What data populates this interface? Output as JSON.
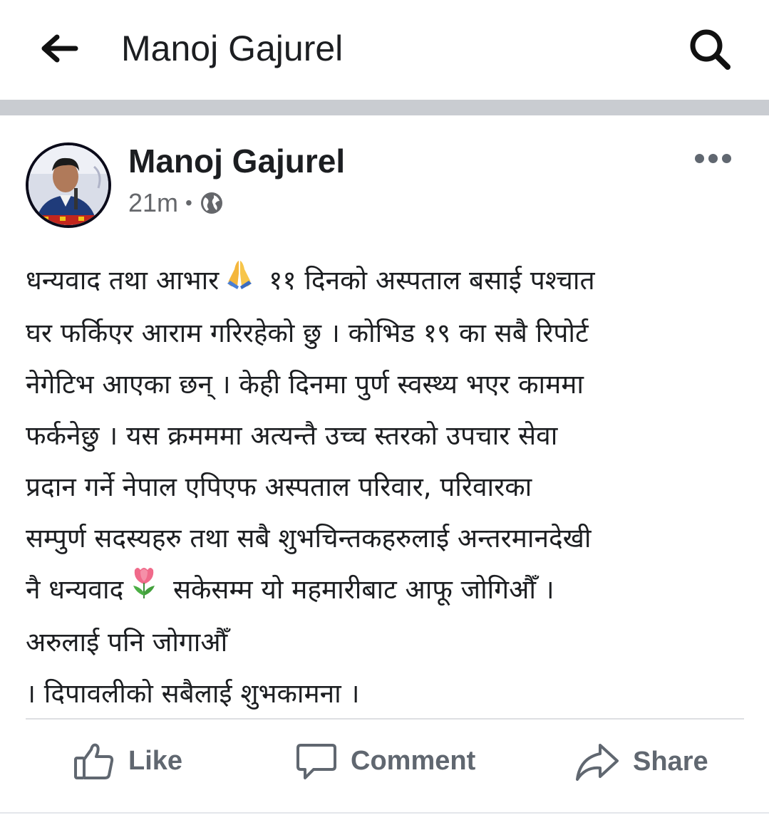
{
  "header": {
    "back_icon": "arrow-left-icon",
    "title": "Manoj Gajurel",
    "search_icon": "search-icon"
  },
  "post": {
    "author": "Manoj Gajurel",
    "time": "21m",
    "separator": "•",
    "privacy_icon": "globe-icon",
    "more_icon": "more-horizontal-icon",
    "text_lines": [
      "धन्यवाद तथा आभार",
      "११ दिनको अस्पताल बसाई पश्चात",
      "घर फर्किएर आराम गरिरहेको छु । कोभिड १९ का सबै रिपोर्ट",
      "नेगेटिभ आएका छन् । केही दिनमा पुर्ण स्वस्थ्य भएर काममा",
      "फर्कनेछु ।  यस क्रमममा अत्यन्तै उच्च स्तरको उपचार सेवा",
      "प्रदान गर्ने नेपाल एपिएफ अस्पताल परिवार, परिवारका",
      "सम्पुर्ण सदस्यहरु तथा सबै शुभचिन्तकहरुलाई अन्तरमानदेखी",
      "नै धन्यवाद",
      "सकेसम्म यो महमारीबाट आफू जोगिऔँ ।",
      "अरुलाई पनि जोगाऔँ",
      " । दिपावलीको सबैलाई शुभकामना ।"
    ],
    "emojis": [
      "folded-hands-emoji",
      "tulip-emoji"
    ]
  },
  "actions": {
    "like_label": "Like",
    "like_icon": "thumbs-up-icon",
    "comment_label": "Comment",
    "comment_icon": "comment-bubble-icon",
    "share_label": "Share",
    "share_icon": "share-arrow-icon"
  },
  "colors": {
    "text": "#1c1e21",
    "secondary": "#65676b",
    "action": "#606770",
    "divider_band": "#c9ccd1"
  }
}
